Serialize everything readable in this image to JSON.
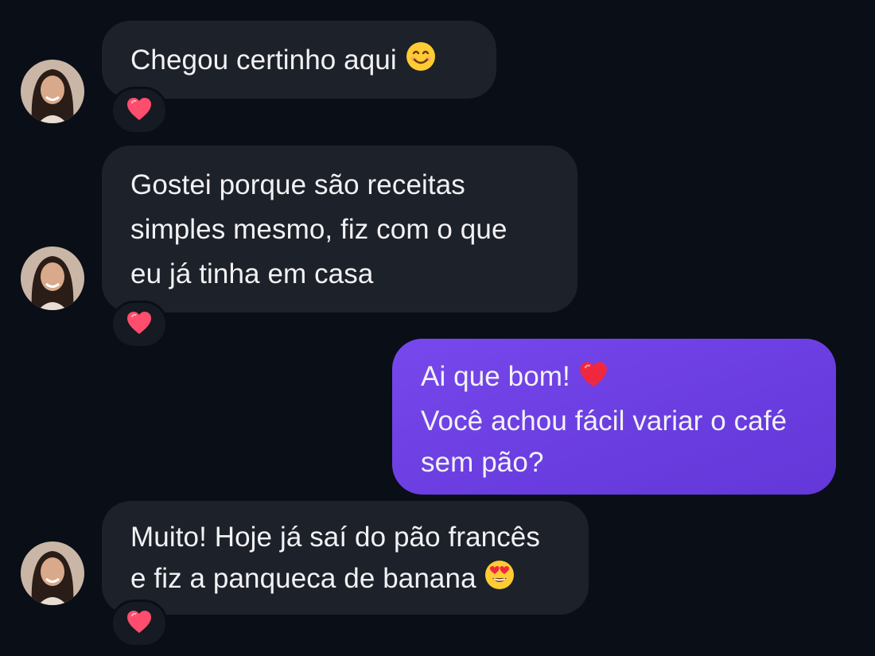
{
  "messages": [
    {
      "direction": "incoming",
      "lines": [
        "Chegou certinho aqui"
      ],
      "trailing_emoji": "smiling-face-icon",
      "reaction": "heart-icon"
    },
    {
      "direction": "incoming",
      "lines": [
        "Gostei porque são receitas",
        "simples mesmo, fiz com o que",
        "eu já tinha em casa"
      ],
      "reaction": "heart-icon"
    },
    {
      "direction": "outgoing",
      "lines": [
        "Ai que bom!",
        "Você achou fácil variar o café",
        "sem pão?"
      ],
      "line1_emoji": "red-heart-icon"
    },
    {
      "direction": "incoming",
      "lines": [
        "Muito! Hoje já saí do pão francês",
        "e fiz a panqueca de banana"
      ],
      "trailing_emoji": "heart-eyes-face-icon",
      "reaction": "heart-icon"
    }
  ],
  "colors": {
    "background": "#0a0e17",
    "incoming_bubble": "#1d2129",
    "outgoing_bubble": "#6a3de0",
    "text": "#f2f2f5",
    "reaction_heart": "#ff4d6d"
  }
}
